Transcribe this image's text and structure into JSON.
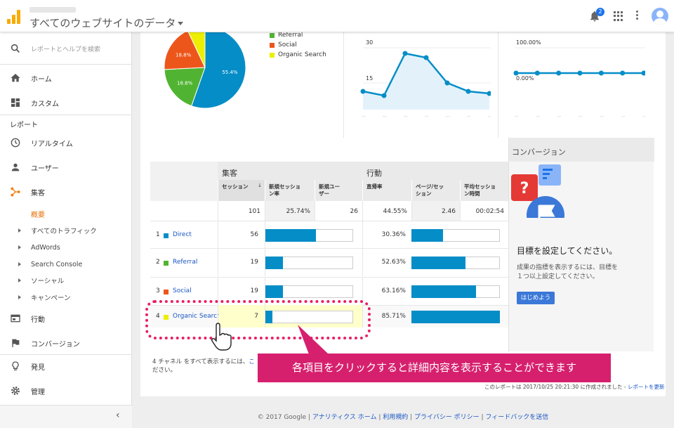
{
  "header": {
    "title": "すべてのウェブサイトのデータ",
    "notification_count": "2"
  },
  "sidebar": {
    "search_placeholder": "レポートとヘルプを検索",
    "home": "ホーム",
    "custom": "カスタム",
    "reports_section": "レポート",
    "realtime": "リアルタイム",
    "users": "ユーザー",
    "acquisition": "集客",
    "overview": "概要",
    "sub_items": [
      "すべてのトラフィック",
      "AdWords",
      "Search Console",
      "ソーシャル",
      "キャンペーン"
    ],
    "behavior": "行動",
    "conversions": "コンバージョン",
    "discover": "発見",
    "admin": "管理"
  },
  "pie": {
    "slices": [
      {
        "label": "Direct",
        "pct": 55.4,
        "color": "#058dc7",
        "text": "55.4%"
      },
      {
        "label": "Referral",
        "pct": 18.8,
        "color": "#50b432",
        "text": "18.8%"
      },
      {
        "label": "Social",
        "pct": 18.8,
        "color": "#ed561b",
        "text": "18.8%"
      },
      {
        "label": "Organic Search",
        "pct": 7.0,
        "color": "#edef00",
        "text": ""
      }
    ],
    "legend": [
      {
        "label": "Referral",
        "color": "#50b432"
      },
      {
        "label": "Social",
        "color": "#ed561b"
      },
      {
        "label": "Organic Search",
        "color": "#edef00"
      }
    ]
  },
  "chart_data": [
    {
      "type": "pie",
      "categories": [
        "Direct",
        "Referral",
        "Social",
        "Organic Search"
      ],
      "values": [
        55.4,
        18.8,
        18.8,
        7.0
      ]
    },
    {
      "type": "area",
      "x": [
        1,
        2,
        3,
        4,
        5,
        6,
        7
      ],
      "values": [
        12,
        10,
        30,
        28,
        16,
        12,
        11
      ],
      "ytick_labels": [
        "30",
        "15"
      ],
      "ylim": [
        0,
        30
      ]
    },
    {
      "type": "line",
      "x": [
        1,
        2,
        3,
        4,
        5,
        6,
        7
      ],
      "values": [
        0,
        0,
        0,
        0,
        0,
        0,
        0
      ],
      "ytick_labels": [
        "100.00%",
        "0.00%"
      ]
    }
  ],
  "table": {
    "group_acquisition": "集客",
    "group_behavior": "行動",
    "columns": [
      "セッション",
      "新規セッション率",
      "新規ユーザー",
      "直帰率",
      "ページ/セッション",
      "平均セッション時間"
    ],
    "column_labels": {
      "sessions": "セッション",
      "new_session_rate": [
        "新規セッショ",
        "ン率"
      ],
      "new_users": [
        "新規ユー",
        "ザー"
      ],
      "bounce": "直帰率",
      "pages_per_session": [
        "ページ/セッ",
        "ション"
      ],
      "avg_duration": [
        "平均セッショ",
        "ン時間"
      ]
    },
    "sort_indicator": "↓",
    "totals": {
      "sessions": "101",
      "new_session_rate": "25.74%",
      "new_users": "26",
      "bounce": "44.55%",
      "pages": "2.46",
      "duration": "00:02:54"
    },
    "rows": [
      {
        "idx": "1",
        "channel": "Direct",
        "color": "#058dc7",
        "sessions": "56",
        "new_bar": 0.56,
        "bounce": "30.36%",
        "bounce_bar": 0.36
      },
      {
        "idx": "2",
        "channel": "Referral",
        "color": "#50b432",
        "sessions": "19",
        "new_bar": 0.19,
        "bounce": "52.63%",
        "bounce_bar": 0.61
      },
      {
        "idx": "3",
        "channel": "Social",
        "color": "#ed561b",
        "sessions": "19",
        "new_bar": 0.19,
        "bounce": "63.16%",
        "bounce_bar": 0.73
      },
      {
        "idx": "4",
        "channel": "Organic Search",
        "color": "#edef00",
        "sessions": "7",
        "new_bar": 0.07,
        "bounce": "85.71%",
        "bounce_bar": 1.0
      }
    ]
  },
  "conversion": {
    "title": "コンバージョン",
    "heading": "目標を設定してください。",
    "desc_line1": "成果の指標を表示するには、目標を",
    "desc_line2": "１つ以上設定してください。",
    "button": "はじめよう"
  },
  "footer": {
    "note_line1": "4 チャネル をすべて表示するには、",
    "note_link": "こ",
    "note_line2": "ださい。",
    "report_info": "このレポートは 2017/10/25 20:21:30 に作成されました - ",
    "report_link": "レポートを更新",
    "copyright": "© 2017 Google",
    "links": [
      "アナリティクス ホーム",
      "利用規約",
      "プライバシー ポリシー",
      "フィードバックを送信"
    ]
  },
  "annotation": {
    "banner": "各項目をクリックすると詳細内容を表示することができます"
  }
}
